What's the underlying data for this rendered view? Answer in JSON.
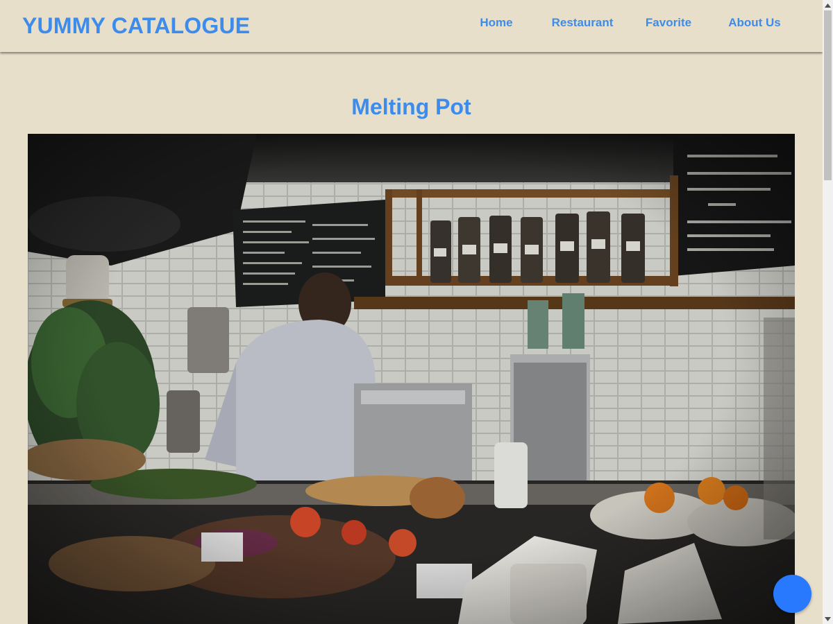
{
  "header": {
    "brand": "YUMMY CATALOGUE",
    "nav": [
      {
        "label": "Home"
      },
      {
        "label": "Restaurant"
      },
      {
        "label": "Favorite"
      },
      {
        "label": "About Us"
      }
    ]
  },
  "restaurant": {
    "name": "Melting Pot"
  },
  "theme": {
    "background": "#e8dfcb",
    "accent": "#3d8bea",
    "fab": "#2979ff"
  },
  "icons": {
    "scroll_up": "triangle-up-icon",
    "scroll_down": "triangle-down-icon"
  }
}
